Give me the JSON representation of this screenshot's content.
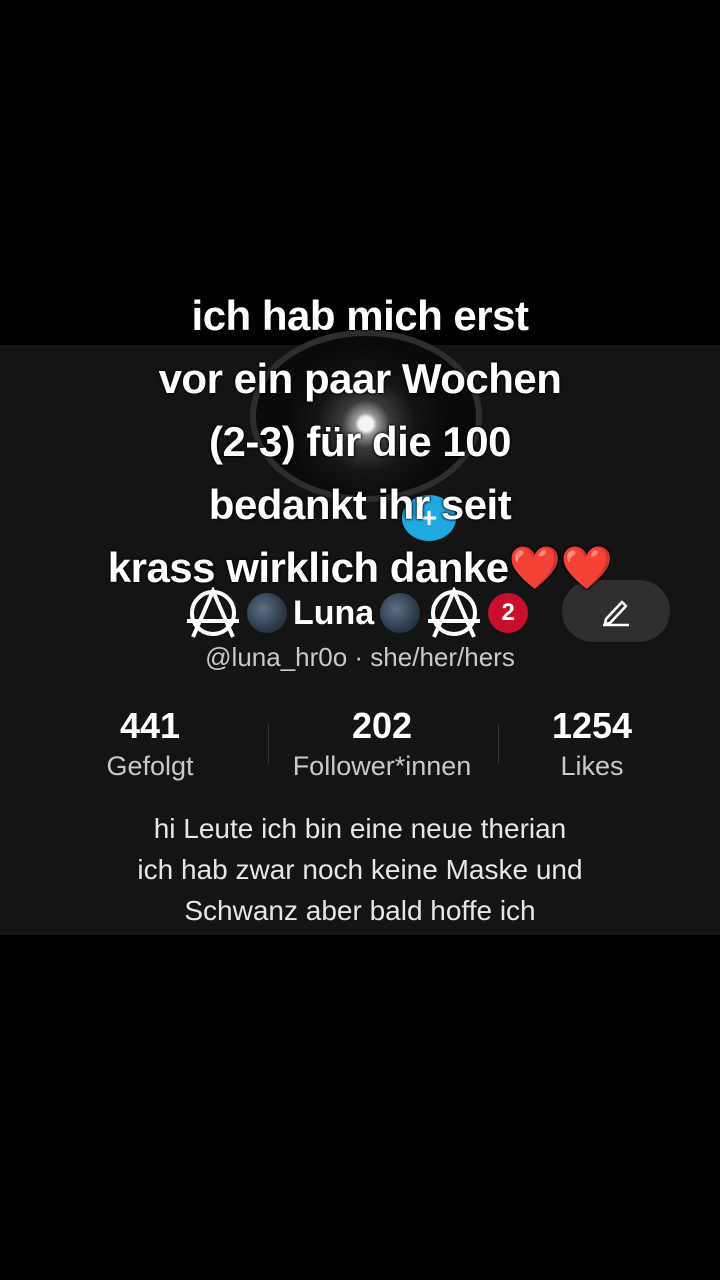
{
  "caption": {
    "lines": [
      "ich hab mich erst",
      "vor ein paar Wochen",
      "(2-3) für die 100",
      "bedankt ihr seit",
      "krass wirklich danke"
    ],
    "emoji": "❤️❤️"
  },
  "profile": {
    "avatar_badge": "+",
    "name": "Luna",
    "notification_count": "2",
    "handle": "@luna_hr0o · she/her/hers",
    "icons": {
      "name_left": "anarchy-symbol-icon",
      "name_moon": "moon-icon",
      "edit": "pencil-icon"
    }
  },
  "stats": [
    {
      "value": "441",
      "label": "Gefolgt"
    },
    {
      "value": "202",
      "label": "Follower*innen"
    },
    {
      "value": "1254",
      "label": "Likes"
    }
  ],
  "bio": {
    "lines": [
      "hi Leute ich bin eine neue therian",
      "ich hab zwar noch keine Maske und",
      "Schwanz aber bald hoffe ich"
    ]
  },
  "colors": {
    "background": "#000000",
    "profile_panel": "#141414",
    "badge_blue": "#20a8e0",
    "notification_red": "#c8102e",
    "heart_red": "#e0122a"
  }
}
